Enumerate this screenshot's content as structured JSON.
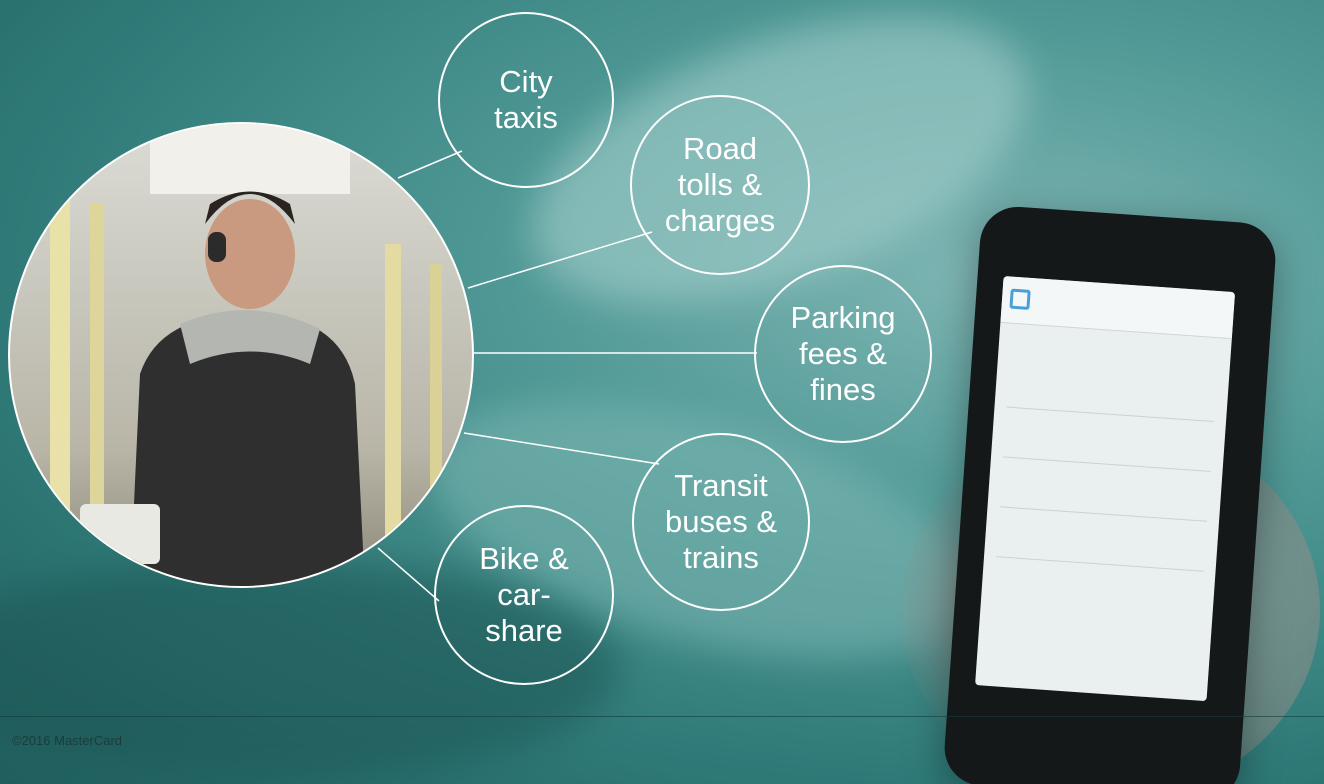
{
  "bubbles": {
    "city_taxis": "City taxis",
    "road_tolls": "Road tolls & charges",
    "parking": "Parking fees & fines",
    "transit": "Transit buses & trains",
    "bike": "Bike & car-share"
  },
  "footer": {
    "copyright": "©2016 MasterCard"
  },
  "colors": {
    "background_teal": "#4f9895",
    "line_white": "#ffffff"
  },
  "icons": {
    "phone": "smartphone-icon",
    "app_logo": "app-logo-icon"
  }
}
